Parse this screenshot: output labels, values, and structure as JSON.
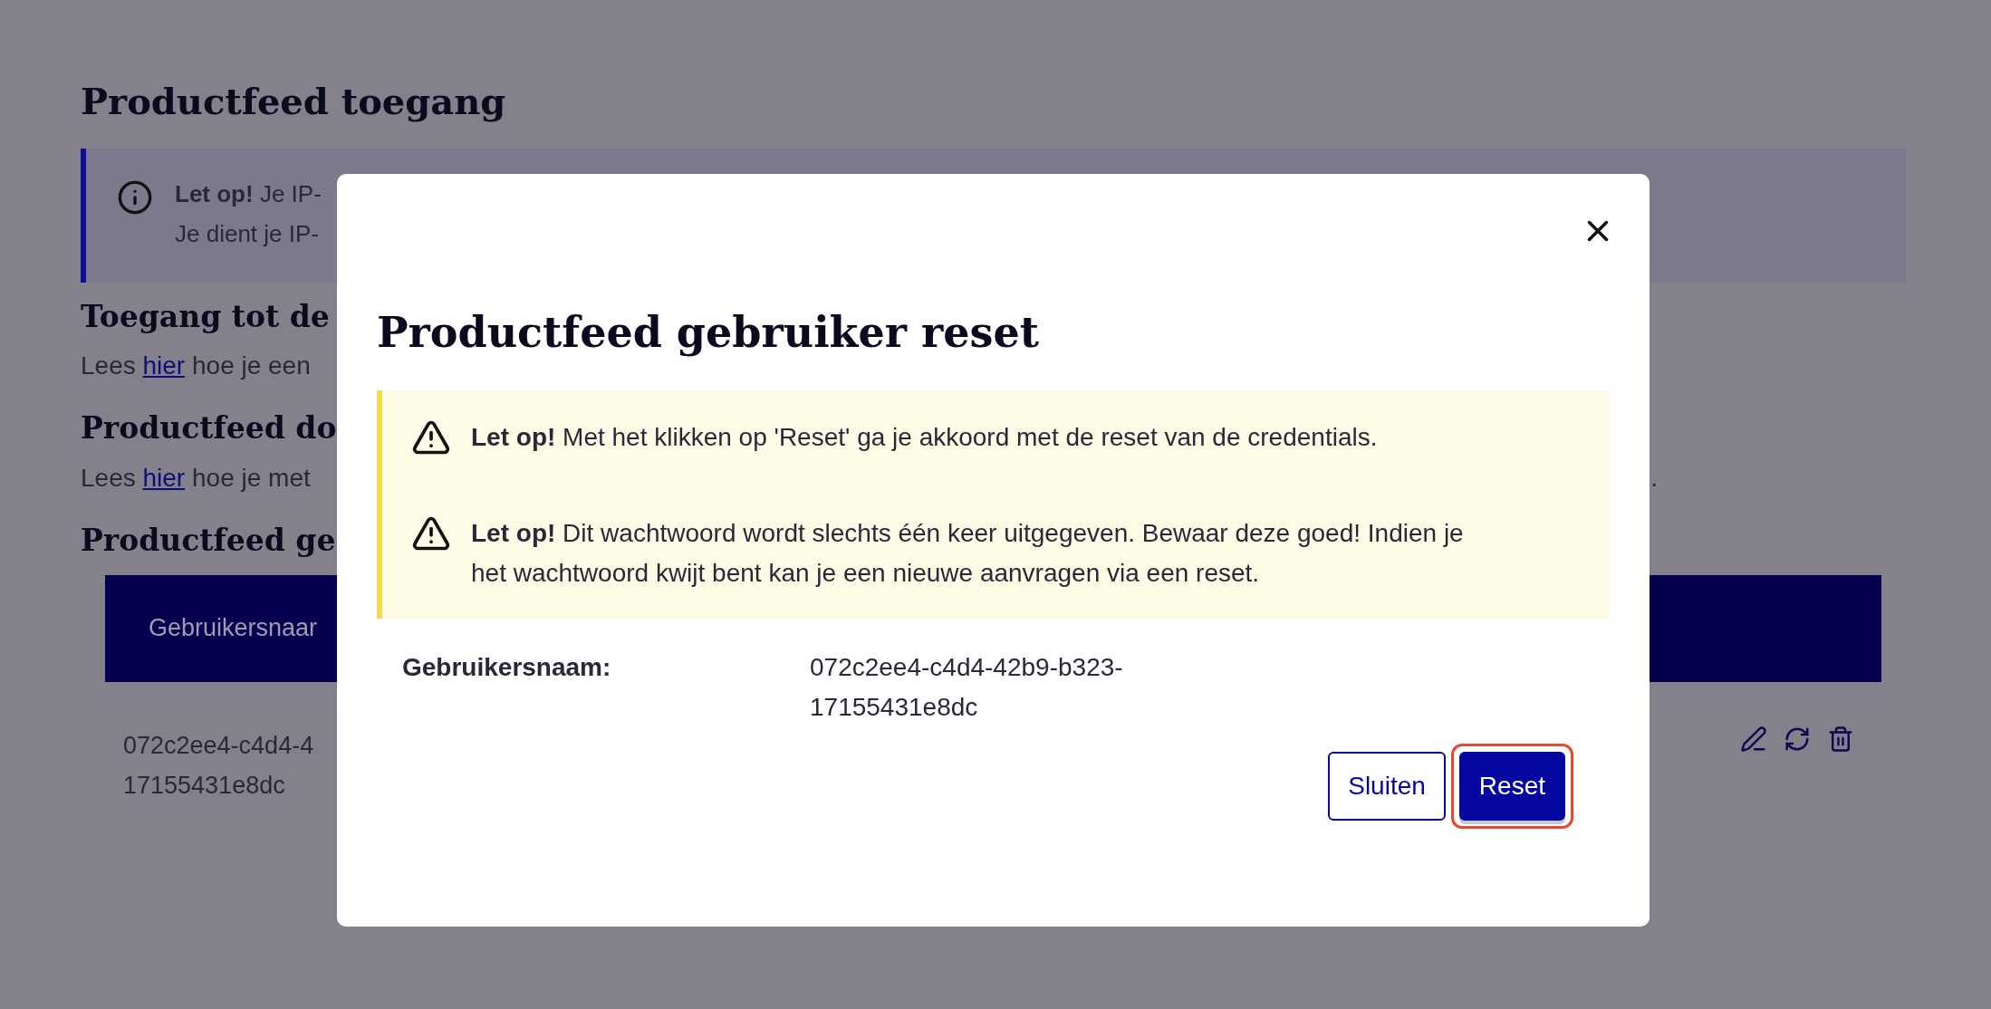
{
  "page": {
    "title": "Productfeed toegang",
    "notice": {
      "lines": [
        "**Let op!** Je IP-",
        "Je dient je IP-"
      ]
    },
    "sections": [
      {
        "heading": "Toegang tot de",
        "before": "Lees ",
        "link": "hier",
        "after": " hoe je een"
      },
      {
        "heading": "Productfeed do",
        "before": "Lees ",
        "link": "hier",
        "after": " hoe je met",
        "tail": "."
      },
      {
        "heading": "Productfeed ge"
      }
    ],
    "table": {
      "columns": [
        "Gebruikersnaar"
      ],
      "rows": [
        {
          "cells": [
            "072c2ee4-c4d4-4\n17155431e8dc"
          ]
        }
      ]
    }
  },
  "modal": {
    "title": "Productfeed gebruiker reset",
    "warnings": [
      "**Let op!** Met het klikken op 'Reset' ga je akkoord met de reset van de credentials.",
      "**Let op!** Dit wachtwoord wordt slechts één keer uitgegeven. Bewaar deze goed! Indien je het wachtwoord kwijt bent kan je een nieuwe aanvragen via een reset."
    ],
    "fields": [
      {
        "label": "Gebruikersnaam:",
        "value": "072c2ee4-c4d4-42b9-b323-17155431e8dc"
      }
    ],
    "buttons": [
      {
        "label": "Sluiten",
        "kind": "secondary",
        "focused": false
      },
      {
        "label": "Reset",
        "kind": "primary",
        "focused": true
      }
    ]
  }
}
